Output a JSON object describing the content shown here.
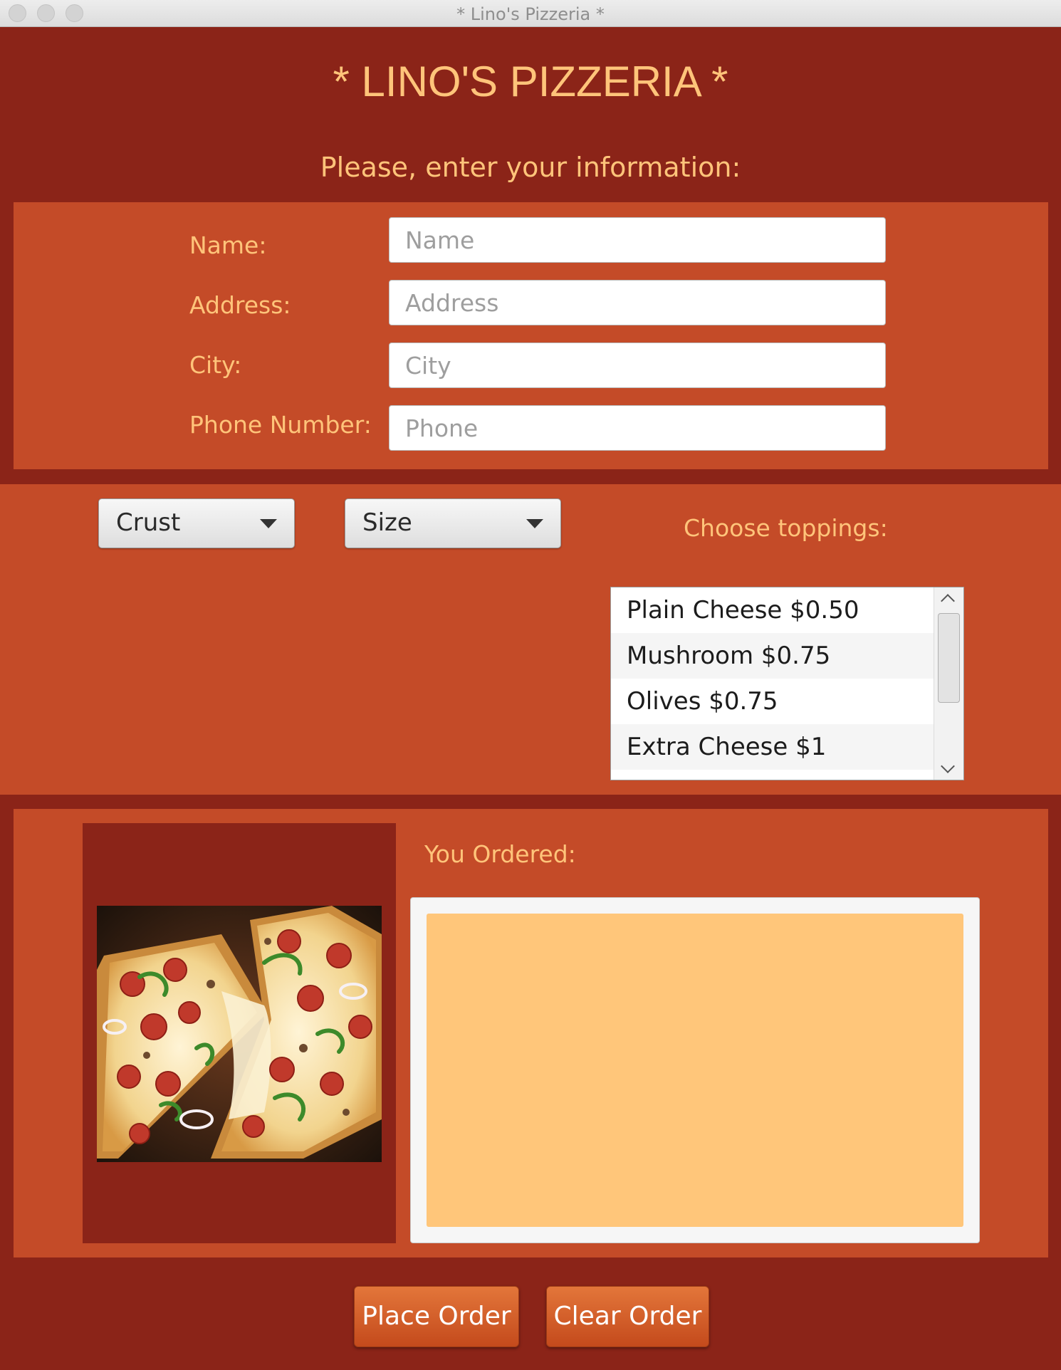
{
  "window": {
    "title": "* Lino's Pizzeria *"
  },
  "header": {
    "title": "* LINO'S PIZZERIA *",
    "subtitle": "Please, enter your information:"
  },
  "form": {
    "name_label": "Name:",
    "name_placeholder": "Name",
    "address_label": "Address:",
    "address_placeholder": "Address",
    "city_label": "City:",
    "city_placeholder": "City",
    "phone_label": "Phone Number:",
    "phone_placeholder": "Phone"
  },
  "options": {
    "crust_label": "Crust",
    "size_label": "Size",
    "toppings_label": "Choose toppings:",
    "toppings": [
      "Plain Cheese $0.50",
      "Mushroom $0.75",
      "Olives $0.75",
      "Extra Cheese $1"
    ]
  },
  "order": {
    "label": "You Ordered:",
    "text": ""
  },
  "actions": {
    "place_label": "Place Order",
    "clear_label": "Clear Order"
  },
  "colors": {
    "background": "#8b2418",
    "panel": "#c44b28",
    "accent_text": "#ffc47a",
    "order_area": "#ffc67a",
    "button": "#d65f2a"
  },
  "icons": {
    "dropdown": "chevron-down-icon",
    "scroll_up": "chevron-up-icon",
    "scroll_down": "chevron-down-icon",
    "pizza": "pizza-image"
  }
}
